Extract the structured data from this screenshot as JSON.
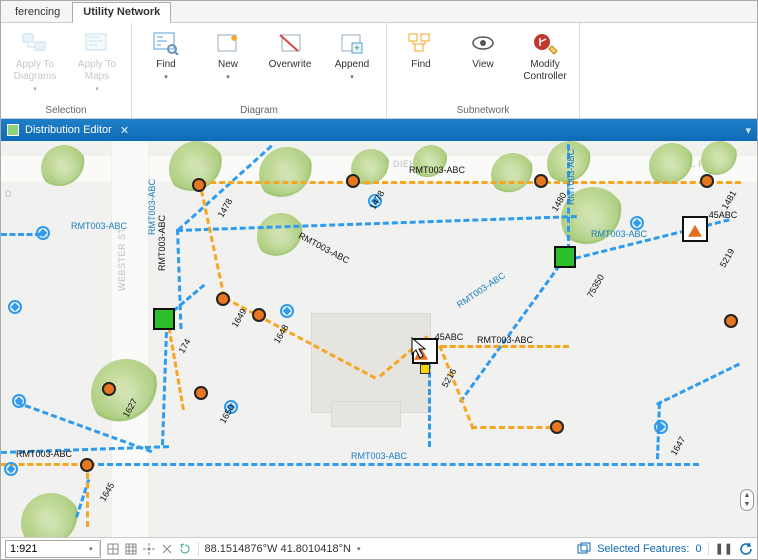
{
  "tabs": {
    "left": "ferencing",
    "active": "Utility Network"
  },
  "ribbon": {
    "groups": [
      {
        "label": "Selection",
        "items": [
          {
            "name": "apply-to-diagrams",
            "label": "Apply To\nDiagrams"
          },
          {
            "name": "apply-to-maps",
            "label": "Apply To\nMaps"
          }
        ]
      },
      {
        "label": "Diagram",
        "items": [
          {
            "name": "find",
            "label": "Find"
          },
          {
            "name": "new",
            "label": "New"
          },
          {
            "name": "overwrite",
            "label": "Overwrite"
          },
          {
            "name": "append",
            "label": "Append"
          }
        ]
      },
      {
        "label": "Subnetwork",
        "items": [
          {
            "name": "find-sub",
            "label": "Find"
          },
          {
            "name": "view",
            "label": "View"
          },
          {
            "name": "modify-controller",
            "label": "Modify\nController"
          }
        ]
      }
    ]
  },
  "pane": {
    "title": "Distribution Editor"
  },
  "map": {
    "road_labels": {
      "webster": "WEBSTER ST",
      "diehl": "W DIEHL RD",
      "diehl2": "W    HL RD",
      "east": "D"
    },
    "link_label": "RMT003-ABC",
    "feature_label_45": "45ABC",
    "node_labels": {
      "n1478": "1478",
      "n1480": "1480",
      "n1481": "1481",
      "n174": "174",
      "n1649": "1649",
      "n1648": "1648",
      "n1627": "1627",
      "n1650": "1650",
      "n1647": "1647",
      "n1645": "1645",
      "n5216": "5216",
      "n5219": "5219",
      "n75350": "75350"
    }
  },
  "footer": {
    "scale": "1:921",
    "coords": "88.1514876°W 41.8010418°N",
    "selected_label": "Selected Features:",
    "selected_count": "0"
  }
}
